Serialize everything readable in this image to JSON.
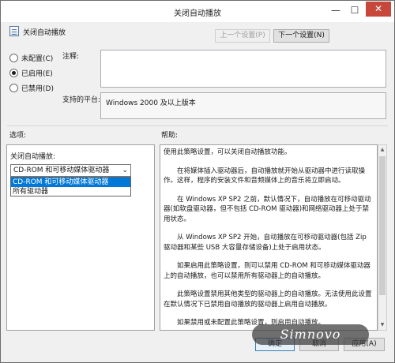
{
  "window": {
    "title": "关闭自动播放",
    "minimize_glyph": "—",
    "maximize_glyph": "☐",
    "close_glyph": "✕"
  },
  "header": {
    "policy_name": "关闭自动播放",
    "prev_label": "上一个设置(P)",
    "next_label": "下一个设置(N)"
  },
  "state": {
    "options": [
      {
        "label": "未配置(C)",
        "checked": false
      },
      {
        "label": "已启用(E)",
        "checked": true
      },
      {
        "label": "已禁用(D)",
        "checked": false
      }
    ]
  },
  "comment": {
    "label": "注释:",
    "value": ""
  },
  "supported": {
    "label": "支持的平台:",
    "value": "Windows 2000 及以上版本"
  },
  "sections": {
    "options_label": "选项:",
    "help_label": "帮助:"
  },
  "options_panel": {
    "field_label": "关闭自动播放:",
    "selected_value": "CD-ROM 和可移动媒体驱动器",
    "dropdown_items": [
      "CD-ROM 和可移动媒体驱动器",
      "所有驱动器"
    ]
  },
  "help": {
    "paragraphs": [
      "使用此策略设置，可以关闭自动播放功能。",
      "在将媒体插入驱动器后，自动播放就开始从驱动器中进行读取操作。这样，程序的安装文件和音频媒体上的音乐将立即启动。",
      "在 Windows XP SP2 之前，默认情况下，自动播放在可移动驱动器(如软盘驱动器，但不包括 CD-ROM 驱动器)和网络驱动器上处于禁用状态。",
      "从 Windows XP SP2 开始，自动播放在可移动驱动器(包括 Zip 驱动器和某些 USB 大容量存储设备)上处于启用状态。",
      "如果启用此策略设置，则可以禁用 CD-ROM 和可移动媒体驱动器上的自动播放，也可以禁用所有驱动器上的自动播放。",
      "此策略设置禁用其他类型的驱动器上的自动播放。无法使用此设置在默认情况下已禁用自动播放的驱动器上启用自动播放。",
      "如果禁用或未配置此策略设置，则启用自动播放。"
    ]
  },
  "footer": {
    "ok_label": "确定",
    "cancel_label": "取消",
    "apply_label": "应用(A)"
  },
  "watermark": {
    "text": "Simnovo"
  },
  "colors": {
    "close_button": "#c7483b",
    "selection": "#0078d7"
  }
}
